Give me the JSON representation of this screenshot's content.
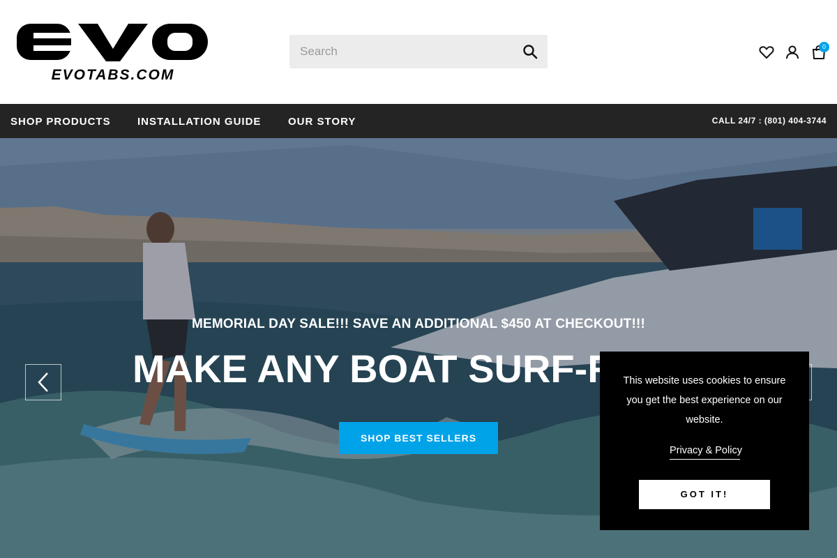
{
  "brand": {
    "logo_text": "EVO",
    "logo_subtext": "EVOTABS.COM"
  },
  "search": {
    "placeholder": "Search"
  },
  "header_icons": [
    "heart-icon",
    "user-icon",
    "shopping-bag-icon"
  ],
  "cart": {
    "count": "0"
  },
  "nav": {
    "items": [
      {
        "label": "SHOP PRODUCTS"
      },
      {
        "label": "INSTALLATION GUIDE"
      },
      {
        "label": "OUR STORY"
      }
    ],
    "call": "CALL 24/7 : (801) 404-3744"
  },
  "hero": {
    "sale_text": "MEMORIAL DAY SALE!!! SAVE AN ADDITIONAL $450 AT CHECKOUT!!!",
    "title": "MAKE ANY BOAT SURF-R",
    "cta_label": "SHOP BEST SELLERS"
  },
  "cookie": {
    "message": "This website uses cookies to ensure you get the best experience on our website.",
    "link": "Privacy & Policy",
    "button": "GOT IT!"
  },
  "colors": {
    "accent": "#00a2e8",
    "nav_bg": "#242424",
    "cookie_bg": "#000000"
  }
}
